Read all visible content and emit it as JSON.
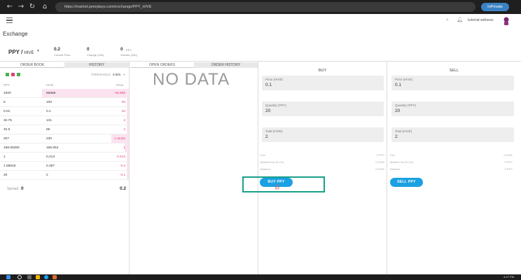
{
  "browser": {
    "url": "https://market.peerplays.com/exchange/PPY_HIVE",
    "inprivate_label": "InPrivate"
  },
  "header": {
    "username": "tutorial-witness"
  },
  "page": {
    "title": "Exchange"
  },
  "ticker": {
    "pair_base": "PPY",
    "pair_quote": "HIVE",
    "current_price_value": "0.2",
    "current_price_label": "Current Price",
    "change_value": "0",
    "change_label": "Change (24h)",
    "volume_value": "0",
    "volume_unit": "PPY",
    "volume_label": "Volume (24h)"
  },
  "order_book": {
    "tabs": [
      "ORDER BOOK",
      "HISTORY"
    ],
    "threshold_label": "THRESHOLD",
    "threshold_value": "0.001",
    "columns": [
      "PPY",
      "HIVE",
      "Price"
    ],
    "rows": [
      {
        "ppy": "1000",
        "hive": "66666",
        "price": "66.666",
        "depth": 1.0
      },
      {
        "ppy": "5",
        "hive": "100",
        "price": "20",
        "depth": 0.02
      },
      {
        "ppy": "0.01",
        "hive": "0.1",
        "price": "10",
        "depth": 0.02
      },
      {
        "ppy": "32.75",
        "hive": "131",
        "price": "4",
        "depth": 0.02
      },
      {
        "ppy": "32.5",
        "hive": "65",
        "price": "2",
        "depth": 0.02
      },
      {
        "ppy": "207",
        "hive": "230",
        "price": "1.11111",
        "depth": 0.2
      },
      {
        "ppy": "166.05393",
        "hive": "166.054",
        "price": "1",
        "depth": 0.05
      },
      {
        "ppy": "1",
        "hive": "0.213",
        "price": "0.213",
        "depth": 0.02
      },
      {
        "ppy": "1.98818",
        "hive": "0.397",
        "price": "0.2",
        "depth": 0.02
      },
      {
        "ppy": "20",
        "hive": "2",
        "price": "0.1",
        "depth": 0.02
      }
    ],
    "spread_label": "Spread",
    "spread_value": "0",
    "spread_price": "0.2"
  },
  "orders": {
    "tabs": [
      "OPEN ORDERS",
      "ORDER HISTORY"
    ],
    "empty_text": "NO DATA"
  },
  "buy": {
    "heading": "BUY",
    "price_label": "Price (HIVE)",
    "price_value": "0.1",
    "quantity_label": "Quantity (PPY)",
    "quantity_value": "20",
    "total_label": "Total (HIVE)",
    "total_value": "2",
    "fee_label": "Fee",
    "fee_value": "0 PPY",
    "market_fee_label": "Market Fee (0.1%)",
    "market_fee_value": "0 HIVE",
    "balance_label": "Balance",
    "balance_value": "0 HIVE",
    "button_label": "BUY PPY"
  },
  "sell": {
    "heading": "SELL",
    "price_label": "Price (HIVE)",
    "price_value": "0.1",
    "quantity_label": "Quantity (PPY)",
    "quantity_value": "20",
    "total_label": "Total (HIVE)",
    "total_value": "2",
    "fee_label": "Fee",
    "fee_value": "0 HIVE",
    "market_fee_label": "Market Fee (0.1%)",
    "market_fee_value": "0 PPY",
    "balance_label": "Balance",
    "balance_value": "0 PPY",
    "button_label": "SELL PPY"
  },
  "taskbar": {
    "clock": "4:27 PM"
  },
  "colors": {
    "accent": "#1ba1e2",
    "sell_price": "#e0407f",
    "highlight": "#17a08a"
  }
}
